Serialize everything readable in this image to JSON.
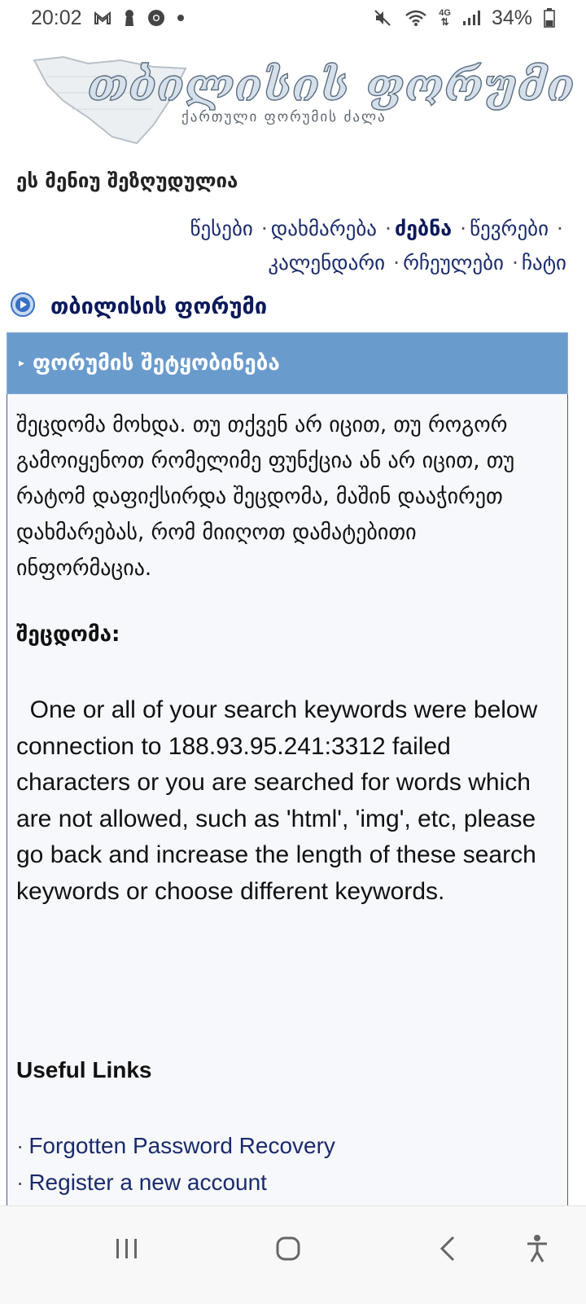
{
  "status_bar": {
    "time": "20:02",
    "battery": "34%",
    "network": "4G"
  },
  "logo": {
    "title": "თბილისის ფორუმი",
    "subtitle": "ქართული ფორუმის ძალა"
  },
  "menu_notice": "ეს მენიუ შეზღუდულია",
  "nav": {
    "items": [
      {
        "label": "წესები",
        "active": false
      },
      {
        "label": "დახმარება",
        "active": false
      },
      {
        "label": "ძებნა",
        "active": true
      },
      {
        "label": "წევრები",
        "active": false
      },
      {
        "label": "კალენდარი",
        "active": false
      },
      {
        "label": "რჩეულები",
        "active": false
      },
      {
        "label": "ჩატი",
        "active": false
      }
    ],
    "separator": "·"
  },
  "breadcrumb": {
    "forum_name": "თბილისის ფორუმი"
  },
  "panel": {
    "title": "ფორუმის შეტყობინება",
    "message": "შეცდომა მოხდა. თუ თქვენ არ იცით, თუ როგორ გამოიყენოთ რომელიმე ფუნქცია ან არ იცით, თუ რატომ დაფიქსირდა შეცდომა, მაშინ დააჭირეთ დახმარებას, რომ მიიღოთ დამატებითი ინფორმაცია.",
    "error_label": "შეცდომა:",
    "error_text": "One or all of your search keywords were below connection to 188.93.95.241:3312 failed characters or you are searched for words which are not allowed, such as 'html', 'img', etc, please go back and increase the length of these search keywords or choose different keywords.",
    "useful_links_title": "Useful Links",
    "useful_links": [
      "Forgotten Password Recovery",
      "Register a new account"
    ]
  },
  "colors": {
    "panel_header": "#6a9bcd",
    "link": "#1a2a6c",
    "panel_bg": "#f6f8fb"
  }
}
